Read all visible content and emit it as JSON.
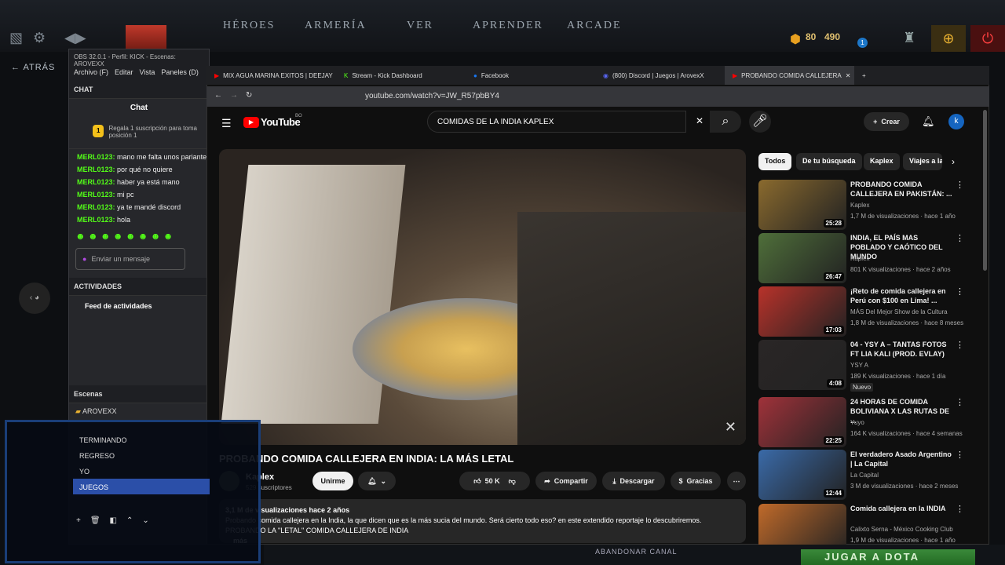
{
  "dota": {
    "menu": [
      "HÉROES",
      "ARMERÍA",
      "VER",
      "APRENDER",
      "ARCADE"
    ],
    "shards": "80",
    "gold": "490",
    "badge": "1",
    "back": "ATRÁS",
    "abandon": "ABANDONAR CANAL",
    "play": "JUGAR A DOTA"
  },
  "obs": {
    "title": "OBS 32.0.1 - Perfil: KICK - Escenas: AROVEXX",
    "menu": [
      "Archivo (F)",
      "Editar",
      "Vista",
      "Paneles (D)"
    ],
    "chat_header": "CHAT",
    "chat_tab": "Chat",
    "sub_promo": "Regala 1 suscripción para toma posición 1",
    "messages": [
      {
        "user": "MERL0123:",
        "text": "mano me falta unos pariante"
      },
      {
        "user": "MERL0123:",
        "text": "por qué no quiere"
      },
      {
        "user": "MERL0123:",
        "text": "haber ya está mano"
      },
      {
        "user": "MERL0123:",
        "text": "mi pc"
      },
      {
        "user": "MERL0123:",
        "text": "ya te mandé discord"
      },
      {
        "user": "MERL0123:",
        "text": "hola"
      }
    ],
    "input_placeholder": "Enviar un mensaje",
    "activities_header": "ACTIVIDADES",
    "feed": "Feed de actividades",
    "scenes_header": "Escenas",
    "scenes": [
      "AROVEXX",
      "TERMINANDO",
      "REGRESO",
      "YO",
      "JUEGOS"
    ]
  },
  "browser": {
    "tabs": [
      "MIX AGUA MARINA EXITOS | DEEJAY",
      "Stream - Kick Dashboard",
      "Facebook",
      "(800) Discord | Juegos | ArovexX",
      "PROBANDO COMIDA CALLEJERA"
    ],
    "url": "youtube.com/watch?v=JW_R57pbBY4"
  },
  "yt": {
    "search": "COMIDAS DE LA INDIA  KAPLEX",
    "create": "Crear",
    "avatar": "k",
    "logo_country": "BO",
    "title": "PROBANDO COMIDA CALLEJERA EN INDIA: LA MÁS LETAL",
    "channel": "Kaplex",
    "subs": "529 suscriptores",
    "join": "Unirme",
    "likes": "50 K",
    "share": "Compartir",
    "download": "Descargar",
    "thanks": "Gracias",
    "views": "3,1 M de visualizaciones  hace 2 años",
    "desc1": "Probando comida callejera en la India, la que dicen que es la más sucia del mundo. Será cierto todo eso? en este extendido reportaje lo descubriremos.",
    "desc2": "PROBANDO LA \"LETAL\" COMIDA CALLEJERA DE INDIA",
    "more": "más",
    "chips": [
      "Todos",
      "De tu búsqueda",
      "Kaplex",
      "Viajes a la"
    ],
    "recs": [
      {
        "title": "PROBANDO COMIDA CALLEJERA EN PAKISTÁN: ...",
        "channel": "Kaplex",
        "meta": "1,7 M de visualizaciones · hace 1 año",
        "dur": "25:28",
        "color": "#8a6a2e"
      },
      {
        "title": "INDIA, EL PAÍS MAS POBLADO Y CAÓTICO DEL MUNDO",
        "channel": "Kaplex",
        "meta": "801 K visualizaciones · hace 2 años",
        "dur": "26:47",
        "color": "#4f6f3a"
      },
      {
        "title": "¡Reto de comida callejera en Perú con $100 en Lima! ...",
        "channel": "MÁS Del Mejor Show de la Cultura",
        "meta": "1,8 M de visualizaciones · hace 8 meses",
        "dur": "17:03",
        "color": "#b8322a"
      },
      {
        "title": "04 - YSY A – TANTAS FOTOS FT LIA KALI (PROD. EVLAY)",
        "channel": "YSY A",
        "meta": "189 K visualizaciones · hace 1 día",
        "dur": "4:08",
        "color": "#2a2626",
        "badge": "Nuevo"
      },
      {
        "title": "24 HORAS DE COMIDA BOLIVIANA X LAS RUTAS DE ...",
        "channel": "Yuyo",
        "meta": "164 K visualizaciones · hace 4 semanas",
        "dur": "22:25",
        "color": "#a0323a"
      },
      {
        "title": "El verdadero Asado Argentino | La Capital",
        "channel": "La Capital",
        "meta": "3 M de visualizaciones · hace 2 meses",
        "dur": "12:44",
        "color": "#3a6aa8"
      },
      {
        "title": "Comida callejera en la INDIA",
        "channel": "Calixto Serna - México Cooking Club",
        "meta": "1,9 M de visualizaciones · hace 1 año",
        "dur": "",
        "color": "#c06a2a"
      }
    ]
  }
}
